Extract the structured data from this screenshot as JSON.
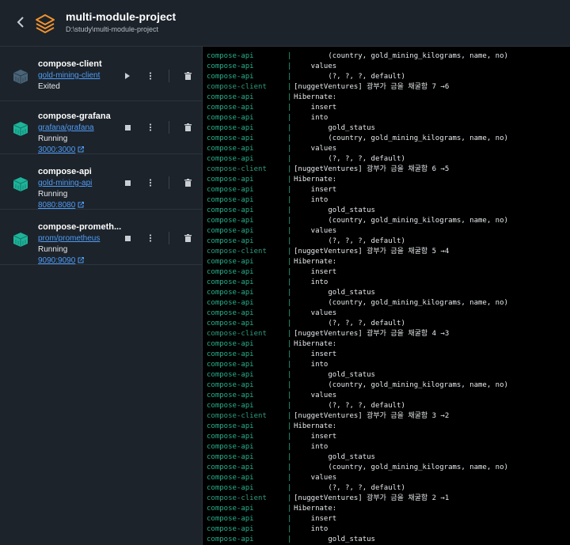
{
  "header": {
    "title": "multi-module-project",
    "path": "D:\\study\\multi-module-project",
    "back_icon": "chevron-left-icon",
    "project_icon": "layers-icon",
    "accent": "#f0922c"
  },
  "containers": [
    {
      "name": "compose-client",
      "image": "gold-mining-client",
      "status": "Exited",
      "port": "",
      "running": false,
      "icon_color": "#4a6478"
    },
    {
      "name": "compose-grafana",
      "image": "grafana/grafana",
      "status": "Running",
      "port": "3000:3000",
      "running": true,
      "icon_color": "#1fb39a"
    },
    {
      "name": "compose-api",
      "image": "gold-mining-api",
      "status": "Running",
      "port": "8080:8080",
      "running": true,
      "icon_color": "#1fb39a"
    },
    {
      "name": "compose-prometh...",
      "image": "prom/prometheus",
      "status": "Running",
      "port": "9090:9090",
      "running": true,
      "icon_color": "#1fb39a"
    }
  ],
  "logs": [
    {
      "svc": "compose-api",
      "msg": "        (country, gold_mining_kilograms, name, no)"
    },
    {
      "svc": "compose-api",
      "msg": "    values"
    },
    {
      "svc": "compose-api",
      "msg": "        (?, ?, ?, default)"
    },
    {
      "svc": "compose-client",
      "msg": "[nuggetVentures] 광부가 금을 채굴함 7 →6"
    },
    {
      "svc": "compose-api",
      "msg": "Hibernate:"
    },
    {
      "svc": "compose-api",
      "msg": "    insert"
    },
    {
      "svc": "compose-api",
      "msg": "    into"
    },
    {
      "svc": "compose-api",
      "msg": "        gold_status"
    },
    {
      "svc": "compose-api",
      "msg": "        (country, gold_mining_kilograms, name, no)"
    },
    {
      "svc": "compose-api",
      "msg": "    values"
    },
    {
      "svc": "compose-api",
      "msg": "        (?, ?, ?, default)"
    },
    {
      "svc": "compose-client",
      "msg": "[nuggetVentures] 광부가 금을 채굴함 6 →5"
    },
    {
      "svc": "compose-api",
      "msg": "Hibernate:"
    },
    {
      "svc": "compose-api",
      "msg": "    insert"
    },
    {
      "svc": "compose-api",
      "msg": "    into"
    },
    {
      "svc": "compose-api",
      "msg": "        gold_status"
    },
    {
      "svc": "compose-api",
      "msg": "        (country, gold_mining_kilograms, name, no)"
    },
    {
      "svc": "compose-api",
      "msg": "    values"
    },
    {
      "svc": "compose-api",
      "msg": "        (?, ?, ?, default)"
    },
    {
      "svc": "compose-client",
      "msg": "[nuggetVentures] 광부가 금을 채굴함 5 →4"
    },
    {
      "svc": "compose-api",
      "msg": "Hibernate:"
    },
    {
      "svc": "compose-api",
      "msg": "    insert"
    },
    {
      "svc": "compose-api",
      "msg": "    into"
    },
    {
      "svc": "compose-api",
      "msg": "        gold_status"
    },
    {
      "svc": "compose-api",
      "msg": "        (country, gold_mining_kilograms, name, no)"
    },
    {
      "svc": "compose-api",
      "msg": "    values"
    },
    {
      "svc": "compose-api",
      "msg": "        (?, ?, ?, default)"
    },
    {
      "svc": "compose-client",
      "msg": "[nuggetVentures] 광부가 금을 채굴함 4 →3"
    },
    {
      "svc": "compose-api",
      "msg": "Hibernate:"
    },
    {
      "svc": "compose-api",
      "msg": "    insert"
    },
    {
      "svc": "compose-api",
      "msg": "    into"
    },
    {
      "svc": "compose-api",
      "msg": "        gold_status"
    },
    {
      "svc": "compose-api",
      "msg": "        (country, gold_mining_kilograms, name, no)"
    },
    {
      "svc": "compose-api",
      "msg": "    values"
    },
    {
      "svc": "compose-api",
      "msg": "        (?, ?, ?, default)"
    },
    {
      "svc": "compose-client",
      "msg": "[nuggetVentures] 광부가 금을 채굴함 3 →2"
    },
    {
      "svc": "compose-api",
      "msg": "Hibernate:"
    },
    {
      "svc": "compose-api",
      "msg": "    insert"
    },
    {
      "svc": "compose-api",
      "msg": "    into"
    },
    {
      "svc": "compose-api",
      "msg": "        gold_status"
    },
    {
      "svc": "compose-api",
      "msg": "        (country, gold_mining_kilograms, name, no)"
    },
    {
      "svc": "compose-api",
      "msg": "    values"
    },
    {
      "svc": "compose-api",
      "msg": "        (?, ?, ?, default)"
    },
    {
      "svc": "compose-client",
      "msg": "[nuggetVentures] 광부가 금을 채굴함 2 →1"
    },
    {
      "svc": "compose-api",
      "msg": "Hibernate:"
    },
    {
      "svc": "compose-api",
      "msg": "    insert"
    },
    {
      "svc": "compose-api",
      "msg": "    into"
    },
    {
      "svc": "compose-api",
      "msg": "        gold_status"
    }
  ],
  "log_separator": "|"
}
